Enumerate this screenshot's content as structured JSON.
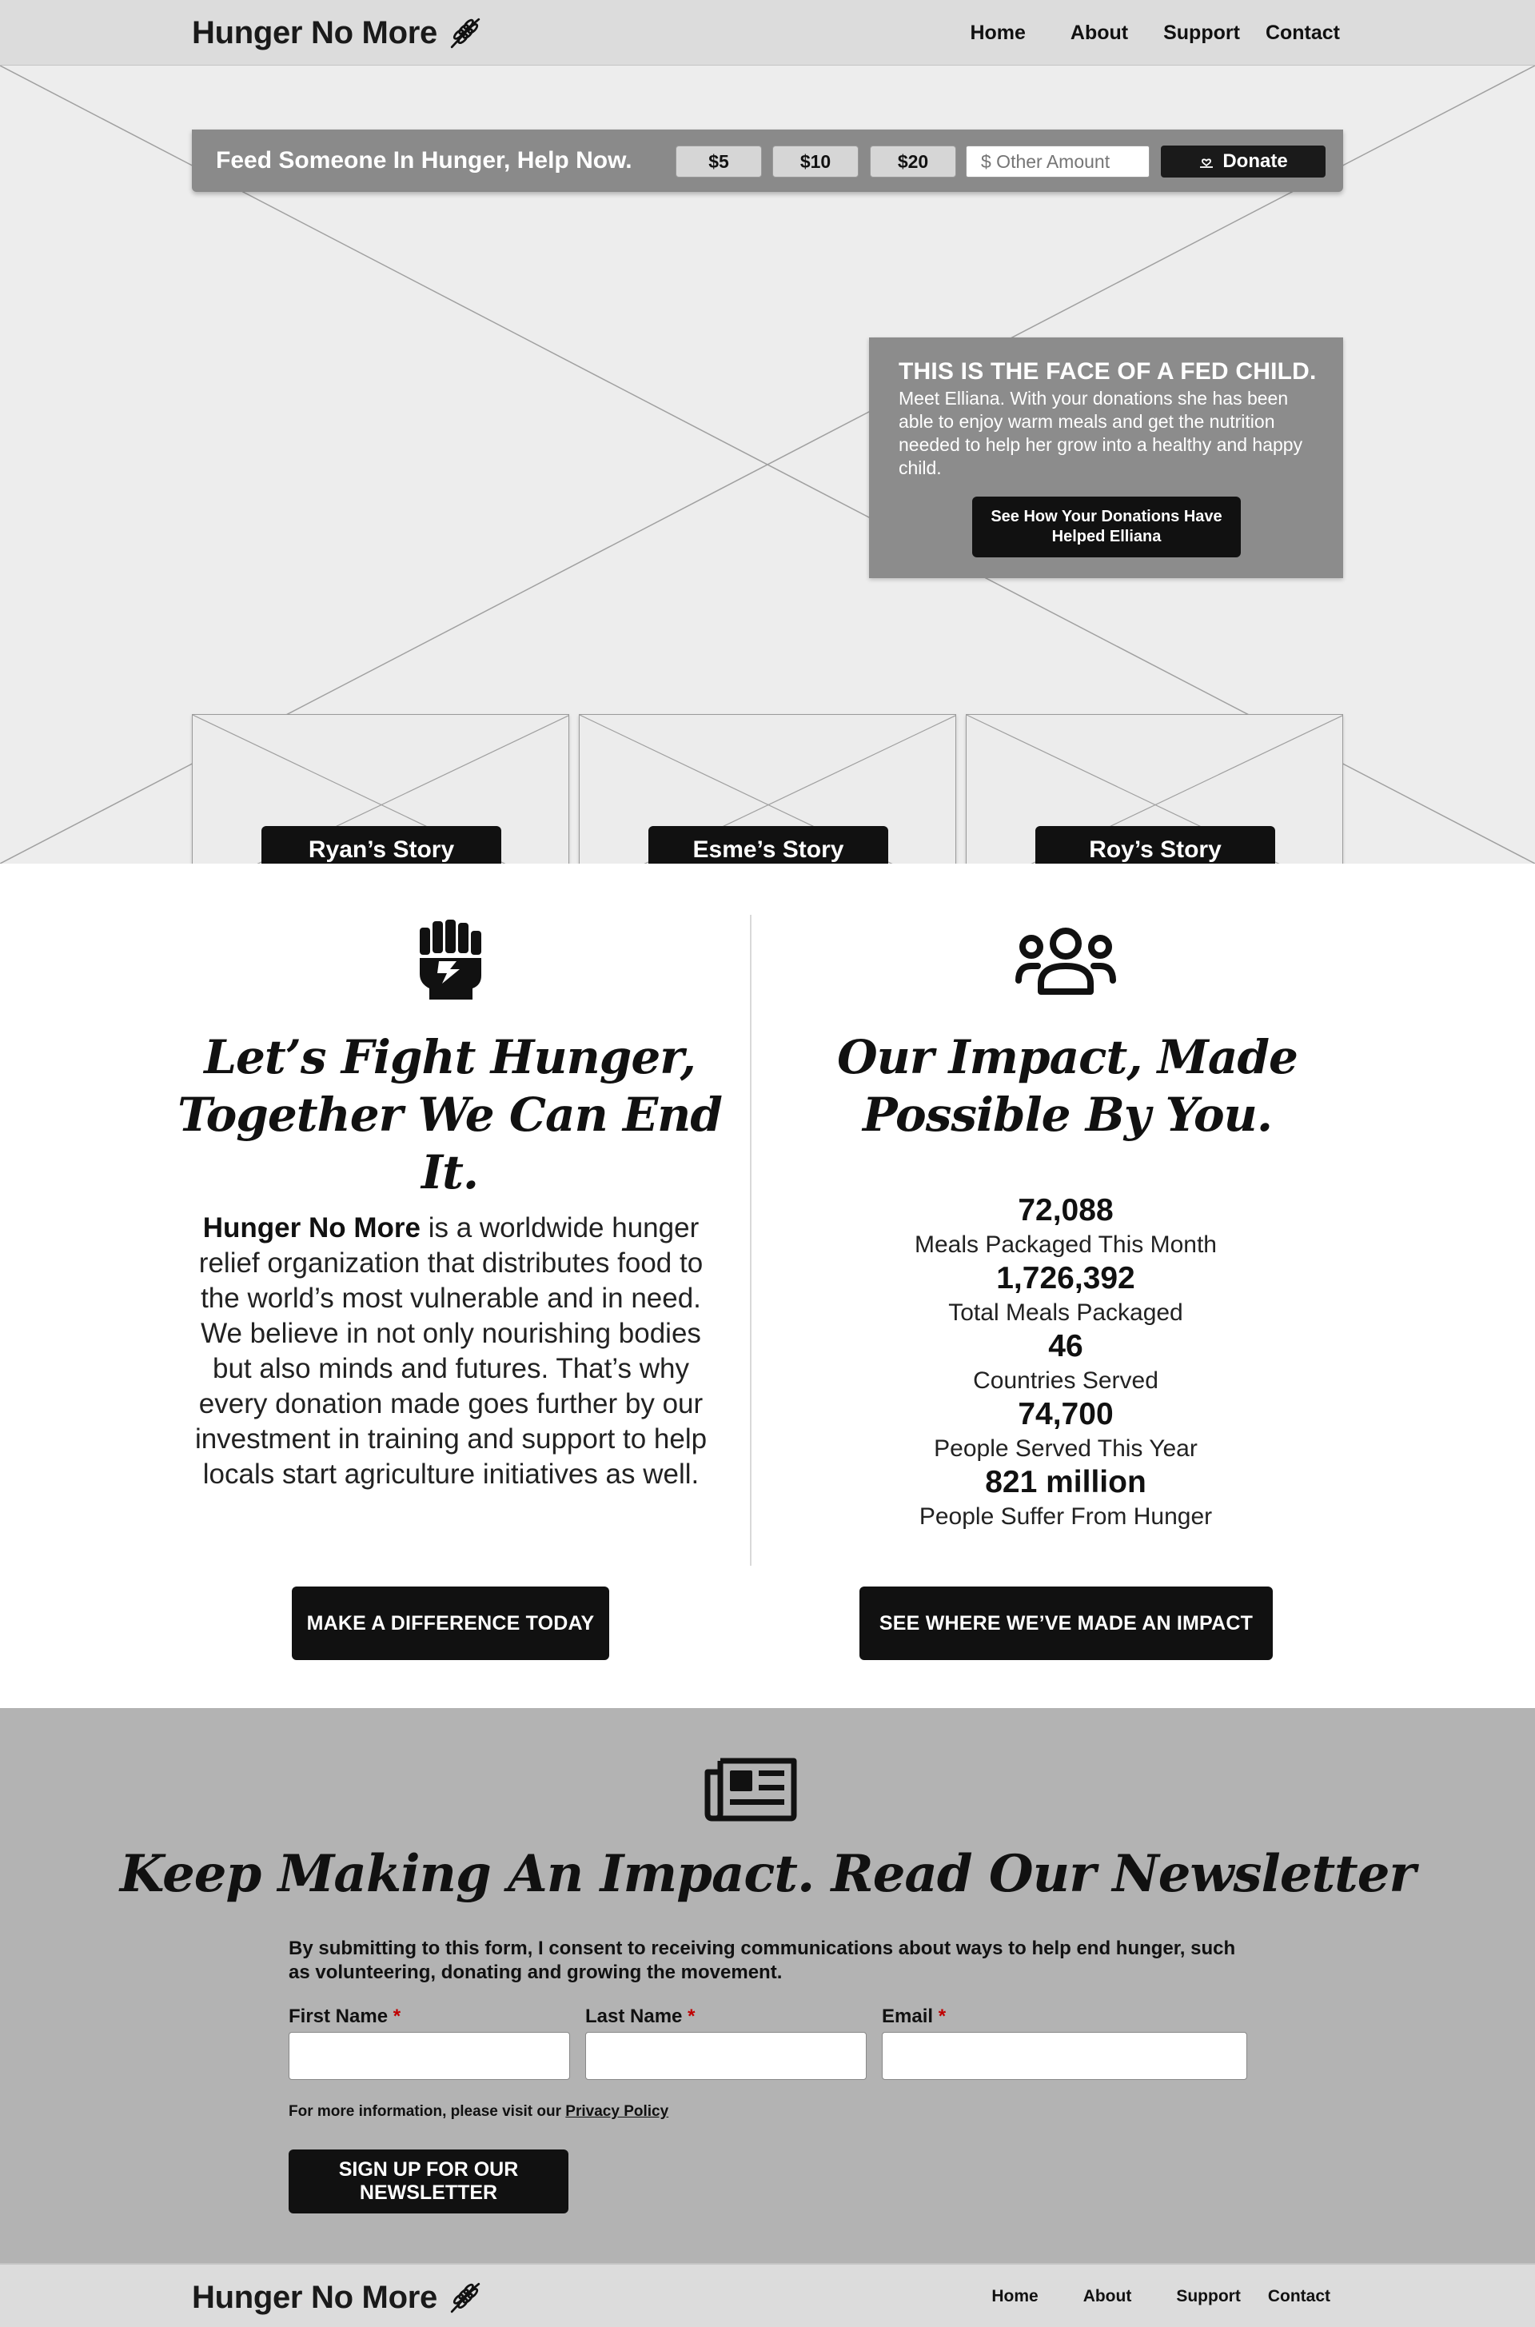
{
  "header": {
    "brand": "Hunger No More",
    "logo_icon": "wheat-icon",
    "nav": [
      "Home",
      "About",
      "Support",
      "Contact"
    ]
  },
  "donate_bar": {
    "tagline": "Feed Someone In Hunger, Help Now.",
    "amounts": [
      "$5",
      "$10",
      "$20"
    ],
    "other_placeholder": "$ Other Amount",
    "donate_label": "Donate",
    "donate_icon": "hand-heart-icon"
  },
  "featured": {
    "title": "THIS IS THE FACE OF A FED CHILD.",
    "body": "Meet Elliana. With your donations she has been able to enjoy warm meals and get the nutrition needed to help her grow into a healthy and happy child.",
    "button": "See How Your Donations Have Helped Elliana"
  },
  "stories": [
    "Ryan’s Story",
    "Esme’s Story",
    "Roy’s Story"
  ],
  "mission": {
    "icon": "raised-fist-icon",
    "headline": "Let’s Fight Hunger, Together We Can End It.",
    "brand_bold": "Hunger No More",
    "body": " is a worldwide hunger relief organization that distributes food to the world’s most vulnerable and in need. We believe in not only nourishing bodies but also minds and futures. That’s why every donation made goes further by our investment in training and support to help locals start agriculture initiatives as well.",
    "button": "MAKE A DIFFERENCE TODAY"
  },
  "impact": {
    "icon": "people-group-icon",
    "headline": "Our Impact, Made Possible By You.",
    "stats": [
      {
        "value": "72,088",
        "label": "Meals Packaged This Month"
      },
      {
        "value": "1,726,392",
        "label": "Total Meals Packaged"
      },
      {
        "value": "46",
        "label": "Countries Served"
      },
      {
        "value": "74,700",
        "label": "People Served This Year"
      },
      {
        "value": "821 million",
        "label": "People Suffer From Hunger"
      }
    ],
    "button": "SEE WHERE WE’VE MADE AN IMPACT"
  },
  "newsletter": {
    "icon": "newspaper-icon",
    "title": "Keep Making An Impact. Read Our Newsletter",
    "consent": "By submitting to this form, I consent to receiving communications about ways to help end hunger, such as volunteering, donating and growing the movement.",
    "fields": [
      "First Name",
      "Last Name",
      "Email"
    ],
    "required_mark": "*",
    "privacy_prefix": "For more information, please visit our ",
    "privacy_link": "Privacy Policy",
    "signup": "SIGN UP FOR OUR NEWSLETTER"
  },
  "footer": {
    "brand": "Hunger No More",
    "nav": [
      "Home",
      "About",
      "Support",
      "Contact"
    ]
  }
}
